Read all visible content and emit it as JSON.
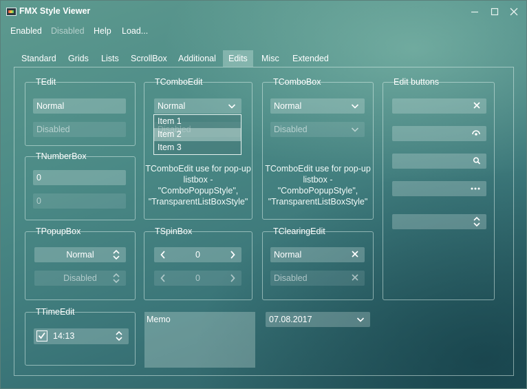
{
  "window": {
    "title": "FMX Style Viewer",
    "controls": {
      "minimize": "—",
      "maximize": "☐",
      "close": "✕"
    }
  },
  "menu": {
    "items": [
      {
        "label": "Enabled",
        "disabled": false
      },
      {
        "label": "Disabled",
        "disabled": true
      },
      {
        "label": "Help",
        "disabled": false
      },
      {
        "label": "Load...",
        "disabled": false
      }
    ]
  },
  "tabs": [
    "Standard",
    "Grids",
    "Lists",
    "ScrollBox",
    "Additional",
    "Edits",
    "Misc",
    "Extended"
  ],
  "active_tab": "Edits",
  "groups": {
    "tedit": {
      "title": "TEdit",
      "normal": "Normal",
      "disabled": "Disabled"
    },
    "tnumberbox": {
      "title": "TNumberBox",
      "value1": "0",
      "value2": "0"
    },
    "tcomboedit": {
      "title": "TComboEdit",
      "value": "Normal",
      "disabled_value": "Disabled",
      "list_items": [
        "Item 1",
        "Item 2",
        "Item 3"
      ],
      "selected_index": 1,
      "note": [
        "TComboEdit use for pop-up",
        "listbox -",
        "\"ComboPopupStyle\",",
        "\"TransparentListBoxStyle\""
      ]
    },
    "tcombobox": {
      "title": "TComboBox",
      "value": "Normal",
      "disabled_value": "Disabled",
      "note": [
        "TComboEdit use for pop-up",
        "listbox -",
        "\"ComboPopupStyle\",",
        "\"TransparentListBoxStyle\""
      ]
    },
    "edit_buttons": {
      "title": "Edit buttons"
    },
    "tpopupbox": {
      "title": "TPopupBox",
      "normal": "Normal",
      "disabled": "Disabled"
    },
    "tspinbox": {
      "title": "TSpinBox",
      "value1": "0",
      "value2": "0"
    },
    "tclearingedit": {
      "title": "TClearingEdit",
      "normal": "Normal",
      "disabled": "Disabled"
    },
    "ttimeedit": {
      "title": "TTimeEdit",
      "time": "14:13",
      "checked": true
    }
  },
  "memo": {
    "text": "Memo"
  },
  "dateedit": {
    "value": "07.08.2017"
  },
  "icons": {
    "clear": "close-icon",
    "password": "eye-icon",
    "search": "search-icon",
    "ellipsis": "ellipsis-icon",
    "spin": "up-down-icon",
    "dropdown": "chevron-down-icon"
  }
}
